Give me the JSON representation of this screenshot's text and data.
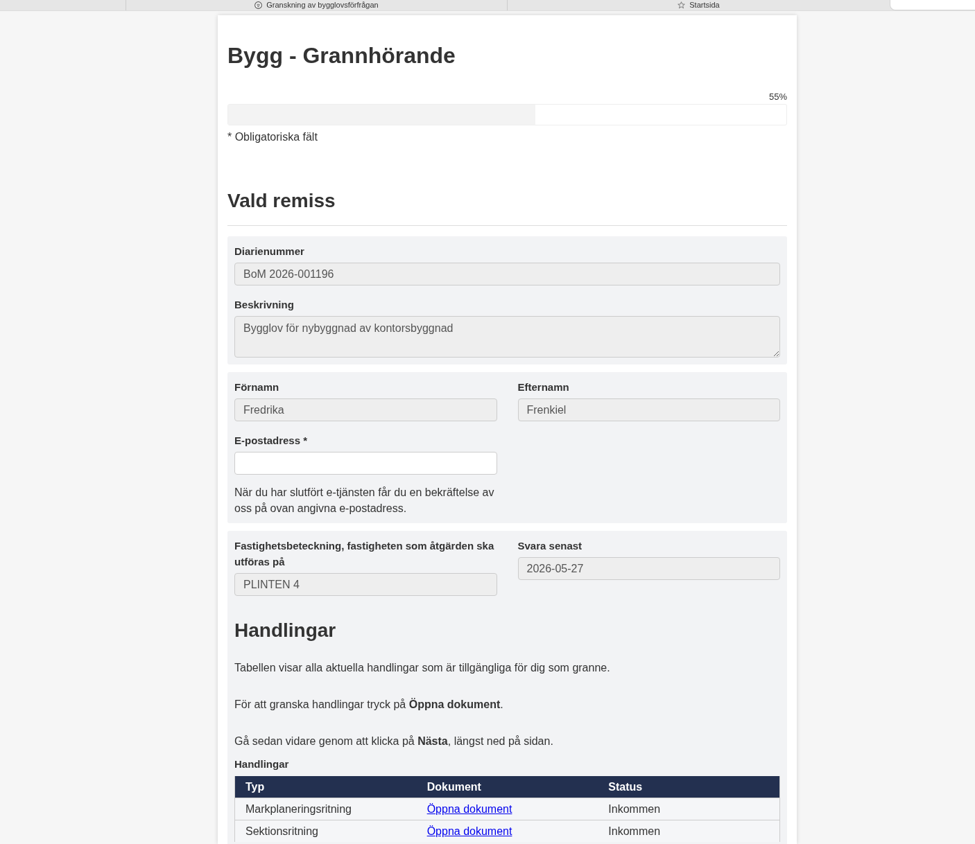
{
  "browser_tabs": [
    {
      "kind": "page",
      "label": "Granskning av bygglovsförfrågan",
      "selected": false
    },
    {
      "kind": "favorites",
      "label": "Startsida",
      "selected": false
    },
    {
      "kind": "blank",
      "selected": true
    }
  ],
  "page_title": "Bygg - Grannhörande",
  "progress": {
    "reading": "55%",
    "level": 0.55
  },
  "required_note": "* Obligatoriska fält",
  "section": {
    "title": "Vald remiss",
    "panels": [
      {
        "kind": "stacked",
        "fields": [
          {
            "kind": "input",
            "label": "Diarienummer",
            "value": "BoM 2026-001196",
            "disabled": true
          },
          {
            "kind": "textarea",
            "label": "Beskrivning",
            "value": "Bygglov för nybyggnad av kontorsbyggnad",
            "disabled": true
          }
        ]
      },
      {
        "kind": "columns",
        "fields": [
          {
            "kind": "input",
            "label": "Förnamn",
            "value": "Fredrika",
            "disabled": true
          },
          {
            "kind": "input",
            "label": "Efternamn",
            "value": "Frenkiel",
            "disabled": true
          },
          {
            "kind": "input",
            "label": "E-postadress *",
            "disabled": false,
            "help": "När du har slutfört e-tjänsten får du en bekräftelse av oss på ovan angivna e-postadress."
          }
        ]
      },
      {
        "kind": "columns",
        "fields": [
          {
            "kind": "input",
            "label": "Fastighetsbeteckning, fastigheten som åtgärden ska utföras på",
            "value": "PLINTEN 4",
            "disabled": true
          },
          {
            "kind": "input",
            "label": "Svara senast",
            "value": "2026-05-27",
            "disabled": true
          }
        ],
        "documents": {
          "heading": "Handlingar",
          "paragraphs": [
            "Tabellen visar alla aktuella handlingar som är tillgängliga för dig som granne.",
            "För att granska handlingar tryck på **Öppna dokument**.",
            "Gå sedan vidare genom att klicka på **Nästa**, längst ned på sidan."
          ],
          "table": {
            "caption": "Handlingar",
            "columns": [
              "Typ",
              "Dokument",
              "Status"
            ],
            "rows": [
              {
                "cells": [
                  {
                    "kind": "text",
                    "text": "Markplaneringsritning"
                  },
                  {
                    "kind": "link",
                    "text": "Öppna dokument"
                  },
                  {
                    "kind": "text",
                    "text": "Inkommen"
                  }
                ]
              },
              {
                "cells": [
                  {
                    "kind": "text",
                    "text": "Sektionsritning"
                  },
                  {
                    "kind": "link",
                    "text": "Öppna dokument"
                  },
                  {
                    "kind": "text",
                    "text": "Inkommen"
                  }
                ]
              }
            ]
          }
        }
      }
    ]
  }
}
